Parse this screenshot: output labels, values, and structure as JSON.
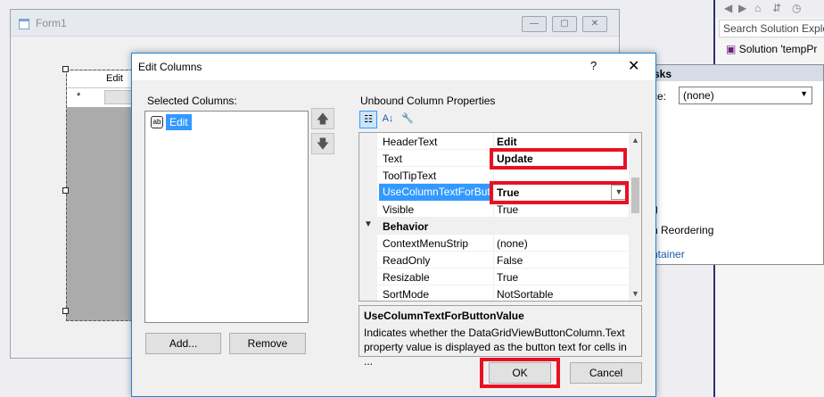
{
  "form1": {
    "title": "Form1",
    "grid_header": "Edit",
    "new_row_marker": "*"
  },
  "solution_explorer": {
    "search_placeholder": "Search Solution Explor",
    "solution_item": "Solution 'tempPr"
  },
  "tasks_panel": {
    "header": "sks",
    "data_source_label": "ce:",
    "data_source_value": "(none)",
    "line_reordering": "n Reordering",
    "line_container": "ntainer",
    "line_g": "g"
  },
  "dialog": {
    "title": "Edit Columns",
    "help": "?",
    "close": "✕",
    "selected_columns_label": "Selected Columns:",
    "selected_item": "Edit",
    "selected_item_icon": "ab",
    "move_up": "🡅",
    "move_down": "🡇",
    "add_button": "Add...",
    "remove_button": "Remove",
    "ok_button": "OK",
    "cancel_button": "Cancel",
    "properties_label": "Unbound Column Properties",
    "properties": [
      {
        "name": "HeaderText",
        "value": "Edit",
        "bold": true
      },
      {
        "name": "Text",
        "value": "Update",
        "bold": true
      },
      {
        "name": "ToolTipText",
        "value": ""
      },
      {
        "name": "UseColumnTextForButtonValue",
        "value": "True",
        "bold": true,
        "selected": true
      }
    ],
    "visible_row": {
      "name": "Visible",
      "value": "True"
    },
    "behavior_category": "Behavior",
    "behavior_properties": [
      {
        "name": "ContextMenuStrip",
        "value": "(none)"
      },
      {
        "name": "ReadOnly",
        "value": "False"
      },
      {
        "name": "Resizable",
        "value": "True"
      },
      {
        "name": "SortMode",
        "value": "NotSortable"
      }
    ],
    "description_title": "UseColumnTextForButtonValue",
    "description_text": "Indicates whether the DataGridViewButtonColumn.Text property value is displayed as the button text for cells in ..."
  },
  "colors": {
    "highlight_red": "#e81123",
    "selection_blue": "#3399ff",
    "dialog_border": "#1c86d8"
  }
}
